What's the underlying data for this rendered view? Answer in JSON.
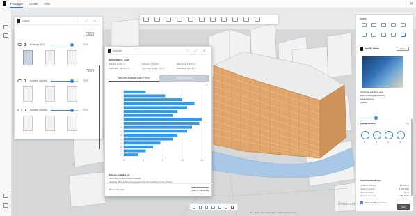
{
  "app": {
    "tabs": [
      {
        "label": "Prototype"
      },
      {
        "label": "Create"
      },
      {
        "label": "Plan"
      }
    ],
    "close_glyph": "✕"
  },
  "layers_panel": {
    "title": "Layers",
    "header_icons": "⋮ ⤢ ✕",
    "buttons": [
      "Add",
      "Add"
    ],
    "layers": [
      {
        "name": "Buildings (3D)",
        "opacity": 0.75,
        "opacity_label": "75 %"
      },
      {
        "name": "Ambient Lighting",
        "opacity": 0.75,
        "opacity_label": "75 %"
      },
      {
        "name": "Ambient Lighting",
        "opacity": 0.75,
        "opacity_label": "75 %"
      }
    ]
  },
  "dialog": {
    "title": "Analytics",
    "header_icons": "? ⤢ ✕",
    "selection_title": "Selection 1 · 3260",
    "stats": [
      "Building Count: 1",
      "Storeys: 7 to 20 m",
      "Wall Area: 2,917 m²",
      "Floor Area: 51,293 m²",
      "Avg Floor Height: 3.3 m",
      "Roof Area: 2,514 m²"
    ],
    "tabs": [
      {
        "label": "Year over Available Data (PV/m²)",
        "active": true
      },
      {
        "label": "Analysis Inputs",
        "active": false
      }
    ],
    "footnotes": [
      "Data are available for:",
      "Floors with Annual Energy Analysis",
      "Modeling: 80% of floor area analyzed by Surrounding Context Shape"
    ],
    "powered_by": "Powered by Esri",
    "copy_button": "Copy to Clipboard"
  },
  "chart_data": {
    "type": "bar",
    "orientation": "horizontal",
    "categories": [
      "1",
      "2",
      "3",
      "4",
      "5",
      "6",
      "7",
      "8",
      "9",
      "10",
      "11",
      "12",
      "13",
      "14",
      "15",
      "16",
      "17"
    ],
    "values": [
      4.5,
      8.5,
      12.0,
      14.5,
      13.0,
      11.0,
      10.0,
      16.0,
      15.5,
      14.0,
      13.0,
      11.0,
      10.0,
      7.5,
      6.0,
      4.5,
      3.0
    ],
    "xlim": [
      0,
      16
    ],
    "xticks": [
      0,
      4,
      8,
      12,
      16
    ],
    "bar_color": "#2b9af3",
    "grid": true
  },
  "right_panel": {
    "title": "Assets",
    "brand": "ArcGIS Urban",
    "brand_button": "Open",
    "description": [
      "Prototype buildings and",
      "apply building and zoning",
      "parameters to",
      "explore."
    ],
    "section_1": "Daylight Factor",
    "section_1_value": "3.2",
    "gauge_labels": [
      "N",
      "E",
      "S",
      "W"
    ],
    "section_2": "Construction Score",
    "rows": [
      {
        "label": "Shadow Volume",
        "value": "45,000 m²"
      },
      {
        "label": "Solar Exposure",
        "value": "4,671 kWh"
      },
      {
        "label": "Wind Comfort",
        "value": "92 %"
      },
      {
        "label": "Energy Demand",
        "value": "1,380 MWh"
      }
    ],
    "checkbox_label": "Show Building Context"
  },
  "map": {
    "watermark": "Grasbrook",
    "basemap_button": "Map",
    "attribution": "Esri, HERE, Garmin, FAO, NOAA, USGS | City of Hamburg"
  },
  "colors": {
    "accent": "#3b82d9",
    "facade": "#e0a66b",
    "water": "#a9c8e8"
  }
}
